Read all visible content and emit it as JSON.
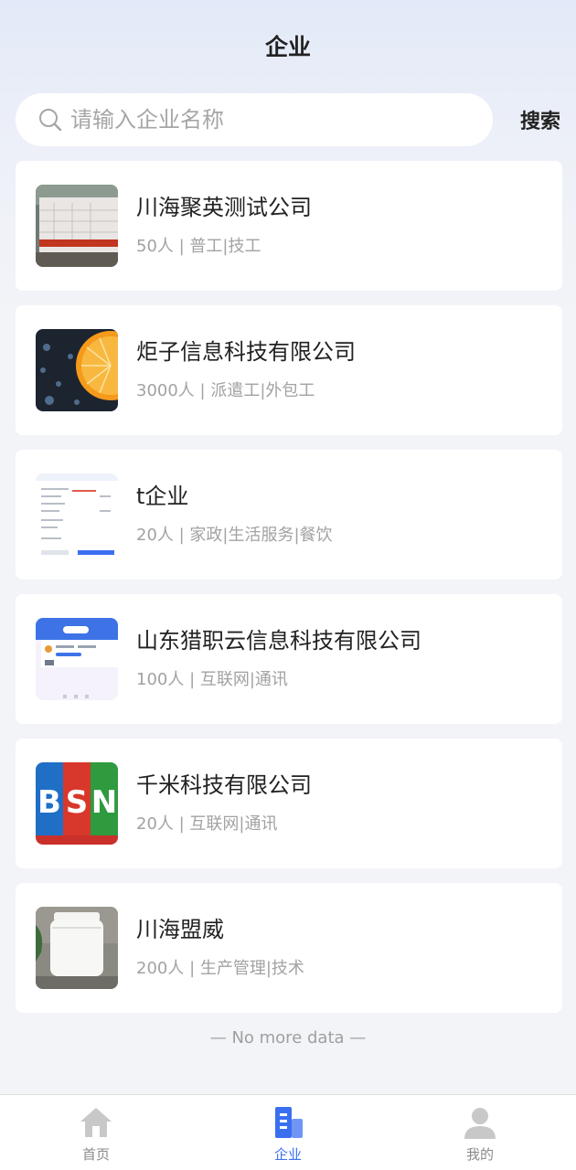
{
  "header": {
    "title": "企业"
  },
  "search": {
    "placeholder": "请输入企业名称",
    "value": "",
    "button_label": "搜索"
  },
  "companies": [
    {
      "name": "川海聚英测试公司",
      "meta": "50人 | 普工|技工",
      "logo": "calendar-photo"
    },
    {
      "name": "炬子信息科技有限公司",
      "meta": "3000人 | 派遣工|外包工",
      "logo": "orange-photo"
    },
    {
      "name": "t企业",
      "meta": "20人 | 家政|生活服务|餐饮",
      "logo": "document-screenshot"
    },
    {
      "name": "山东猎职云信息科技有限公司",
      "meta": "100人 | 互联网|通讯",
      "logo": "app-screenshot"
    },
    {
      "name": "千米科技有限公司",
      "meta": "20人 | 互联网|通讯",
      "logo": "bsn-logo",
      "logo_text": [
        "B",
        "S",
        "N"
      ]
    },
    {
      "name": "川海盟威",
      "meta": "200人 | 生产管理|技术",
      "logo": "container-photo"
    }
  ],
  "footer_note": "— No more data —",
  "tabbar": {
    "items": [
      {
        "label": "首页",
        "icon": "home-icon",
        "active": false
      },
      {
        "label": "企业",
        "icon": "building-icon",
        "active": true
      },
      {
        "label": "我的",
        "icon": "user-icon",
        "active": false
      }
    ]
  },
  "colors": {
    "accent": "#3a6ff0",
    "inactive": "#8a8a8a",
    "background": "#f3f4f8"
  }
}
